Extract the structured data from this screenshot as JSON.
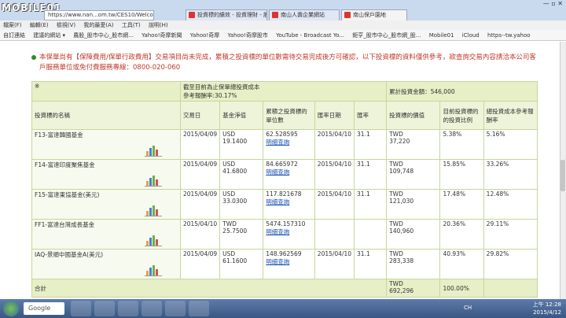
{
  "browser": {
    "logo_text": "MOBILE01",
    "address": "https://www.nan...om.tw/CES10/Welcom",
    "tabs": [
      {
        "label": "投資標的績效 - 投資理財 - 股票..."
      },
      {
        "label": "南山人壽企業網站"
      },
      {
        "label": "南山保戶園地"
      }
    ],
    "window_buttons": "— ▫ ✕",
    "menu": [
      "檔案(F)",
      "編輯(E)",
      "檢視(V)",
      "我的最愛(A)",
      "工具(T)",
      "說明(H)"
    ],
    "favorites": [
      "自訂連結",
      "建議的網站 ▾",
      "農股_股市中心_股市網...",
      "Yahoo!奇摩新聞",
      "Yahoo!奇摩",
      "Yahoo!奇摩股市",
      "YouTube - Broadcast Yo...",
      "鉅亨_股市中心_股市網_股...",
      "Mobile01",
      "iCloud",
      "https--tw.yahoo"
    ]
  },
  "notice": "本保單尚有【保障費用/保單行政費用】交易項目尚未完成，累積之投資標的單位數需待交易完成後方可確認，以下投資標的資料僅供參考，欲查詢交易內容請洽本公司客戶服務單位或免付費服務專線：0800-020-060",
  "table": {
    "summary": {
      "mark": "※",
      "cost_title": "截至目前為止保單總投資成本",
      "cost_roi": "參考報酬率:30.17%",
      "total_invest": "累計投資金額：546,000"
    },
    "headers": [
      "投資標的名稱",
      "交易日",
      "基金淨值",
      "累積之投資標的單位數",
      "匯率日期",
      "匯率",
      "投資標的價值",
      "目前投資標的的投資比例",
      "總投資成本參考報酬率"
    ],
    "detail_link": "明細查詢",
    "rows": [
      {
        "name": "F13-富達韓國基金",
        "date": "2015/04/09",
        "nav_cur": "USD",
        "nav": "19.1400",
        "units": "62.528595",
        "has_link": true,
        "rate_date": "2015/04/10",
        "rate": "31.1",
        "val_cur": "TWD",
        "value": "37,220",
        "ratio": "5.38%",
        "roi": "5.16%"
      },
      {
        "name": "F14-富達印度聚焦基金",
        "date": "2015/04/09",
        "nav_cur": "USD",
        "nav": "41.6800",
        "units": "84.665972",
        "has_link": true,
        "rate_date": "2015/04/10",
        "rate": "31.1",
        "val_cur": "TWD",
        "value": "109,748",
        "ratio": "15.85%",
        "roi": "33.26%"
      },
      {
        "name": "F15-富達東協基金(美元)",
        "date": "2015/04/09",
        "nav_cur": "USD",
        "nav": "33.0300",
        "units": "117.821678",
        "has_link": true,
        "rate_date": "2015/04/10",
        "rate": "31.1",
        "val_cur": "TWD",
        "value": "121,030",
        "ratio": "17.48%",
        "roi": "12.48%"
      },
      {
        "name": "FF1-富達台灣成長基金",
        "date": "2015/04/10",
        "nav_cur": "TWD",
        "nav": "25.7500",
        "units": "5474.157310",
        "has_link": true,
        "rate_date": "",
        "rate": "",
        "val_cur": "TWD",
        "value": "140,960",
        "ratio": "20.36%",
        "roi": "29.11%"
      },
      {
        "name": "IAQ-景順中國基金A(美元)",
        "date": "2015/04/09",
        "nav_cur": "USD",
        "nav": "61.1600",
        "units": "148.962569",
        "has_link": true,
        "rate_date": "2015/04/10",
        "rate": "31.1",
        "val_cur": "TWD",
        "value": "283,338",
        "ratio": "40.93%",
        "roi": "29.82%"
      }
    ],
    "total": {
      "label": "合計",
      "val_cur": "TWD",
      "value": "692,296",
      "ratio": "100.00%"
    }
  },
  "taskbar": {
    "search": "Google",
    "tray_time": "上午 12:28",
    "tray_date": "2015/4/12",
    "tray_lang": "CH"
  }
}
